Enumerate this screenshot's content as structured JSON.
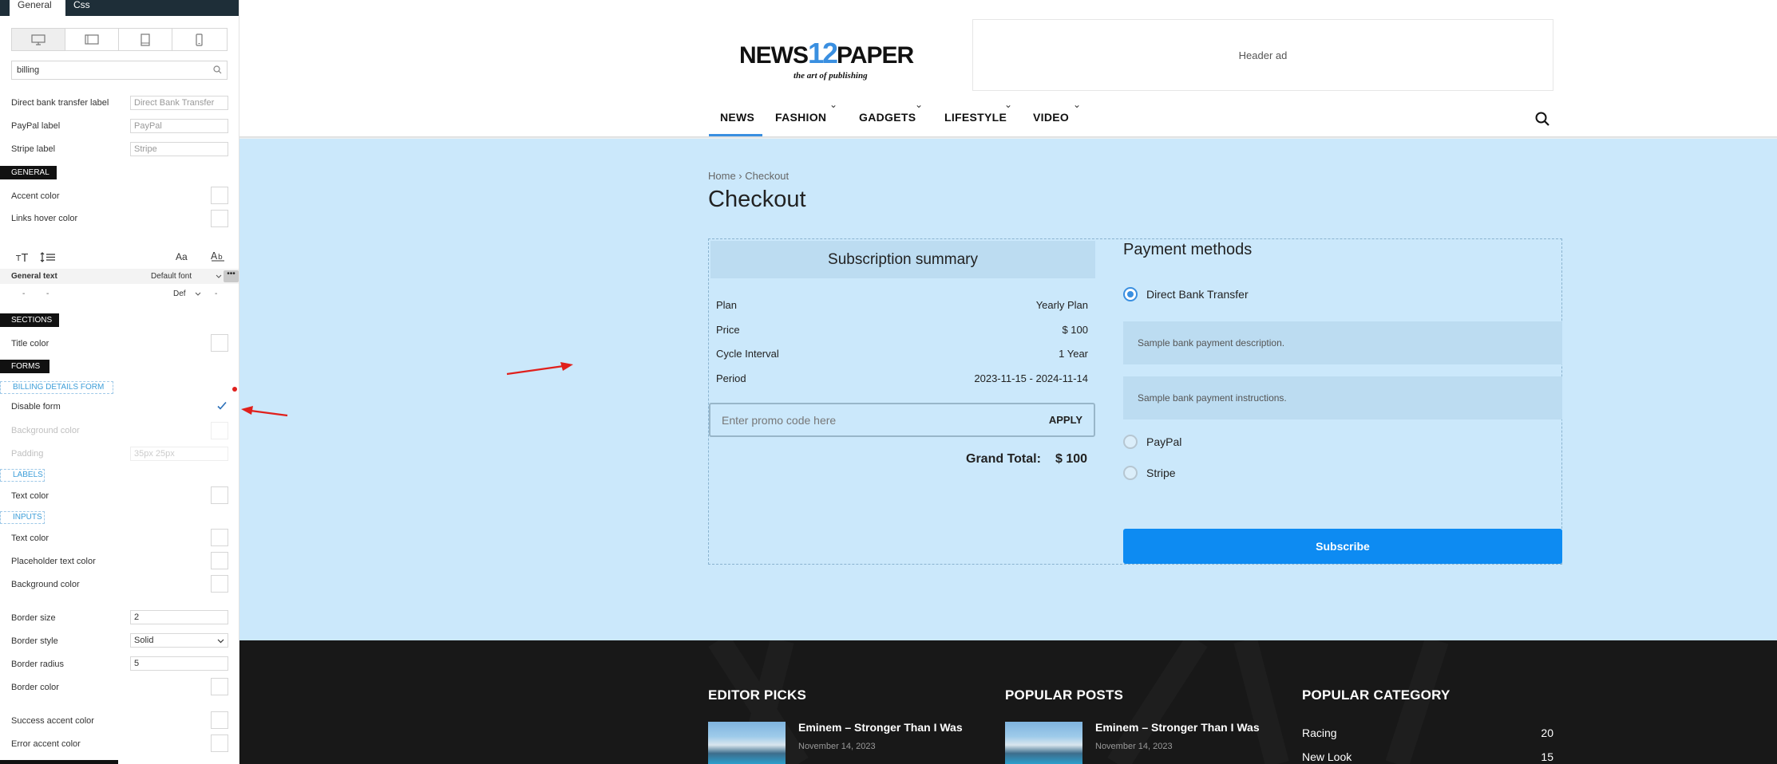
{
  "sidebar": {
    "tabs": [
      "General",
      "Css"
    ],
    "search": "billing",
    "fields": [
      {
        "label": "Direct bank transfer label",
        "value": "Direct Bank Transfer"
      },
      {
        "label": "PayPal label",
        "value": "PayPal"
      },
      {
        "label": "Stripe label",
        "value": "Stripe"
      }
    ],
    "sec_general": "GENERAL",
    "accent_color": "Accent color",
    "links_hover_color": "Links hover color",
    "typo_icons": {
      "aa": "Aa"
    },
    "general_text": "General text",
    "default_font": "Default font",
    "typo_row2": {
      "dash1": "-",
      "dash2": "-",
      "def": "Def",
      "dash3": "-"
    },
    "sec_sections": "SECTIONS",
    "title_color": "Title color",
    "sec_forms": "FORMS",
    "billing_details_form": "BILLING DETAILS FORM",
    "disable_form": "Disable form",
    "background_color_dim": "Background color",
    "padding": "Padding",
    "padding_value": "35px 25px",
    "labels": "LABELS",
    "labels_text_color": "Text color",
    "inputs": "INPUTS",
    "inputs_text_color": "Text color",
    "placeholder_text_color": "Placeholder text color",
    "inputs_background_color": "Background color",
    "border_size": "Border size",
    "border_size_value": "2",
    "border_style": "Border style",
    "border_style_value": "Solid",
    "border_radius": "Border radius",
    "border_radius_value": "5",
    "border_color": "Border color",
    "success_accent_color": "Success accent color",
    "error_accent_color": "Error accent color"
  },
  "header": {
    "logo": {
      "news": "NEWS",
      "num": "12",
      "paper": "PAPER",
      "tagline": "the art of publishing"
    },
    "ad": "Header ad",
    "nav": [
      "NEWS",
      "FASHION",
      "GADGETS",
      "LIFESTYLE",
      "VIDEO"
    ],
    "active_nav": "NEWS"
  },
  "checkout": {
    "breadcrumb": "Home › Checkout",
    "title": "Checkout",
    "summary_title": "Subscription summary",
    "rows": [
      {
        "label": "Plan",
        "value": "Yearly Plan"
      },
      {
        "label": "Price",
        "value": "$ 100"
      },
      {
        "label": "Cycle Interval",
        "value": "1 Year"
      },
      {
        "label": "Period",
        "value": "2023-11-15 - 2024-11-14"
      }
    ],
    "promo_placeholder": "Enter promo code here",
    "apply": "APPLY",
    "grand_total_label": "Grand Total:",
    "grand_total_value": "$ 100",
    "payment_title": "Payment methods",
    "methods": [
      {
        "label": "Direct Bank Transfer",
        "selected": true
      },
      {
        "label": "PayPal",
        "selected": false
      },
      {
        "label": "Stripe",
        "selected": false
      }
    ],
    "bank_description": "Sample bank payment description.",
    "bank_instructions": "Sample bank payment instructions.",
    "subscribe": "Subscribe"
  },
  "footer": {
    "editor_picks": "EDITOR PICKS",
    "popular_posts": "POPULAR POSTS",
    "popular_category": "POPULAR CATEGORY",
    "article_title": "Eminem – Stronger Than I Was",
    "article_date": "November 14, 2023",
    "categories": [
      {
        "name": "Racing",
        "count": "20"
      },
      {
        "name": "New Look",
        "count": "15"
      }
    ]
  },
  "colors": {
    "accent": "#0d8bf2",
    "band_bg": "#cbe8fb",
    "annotation_red": "#e0201c",
    "footer_bg": "#181818"
  }
}
